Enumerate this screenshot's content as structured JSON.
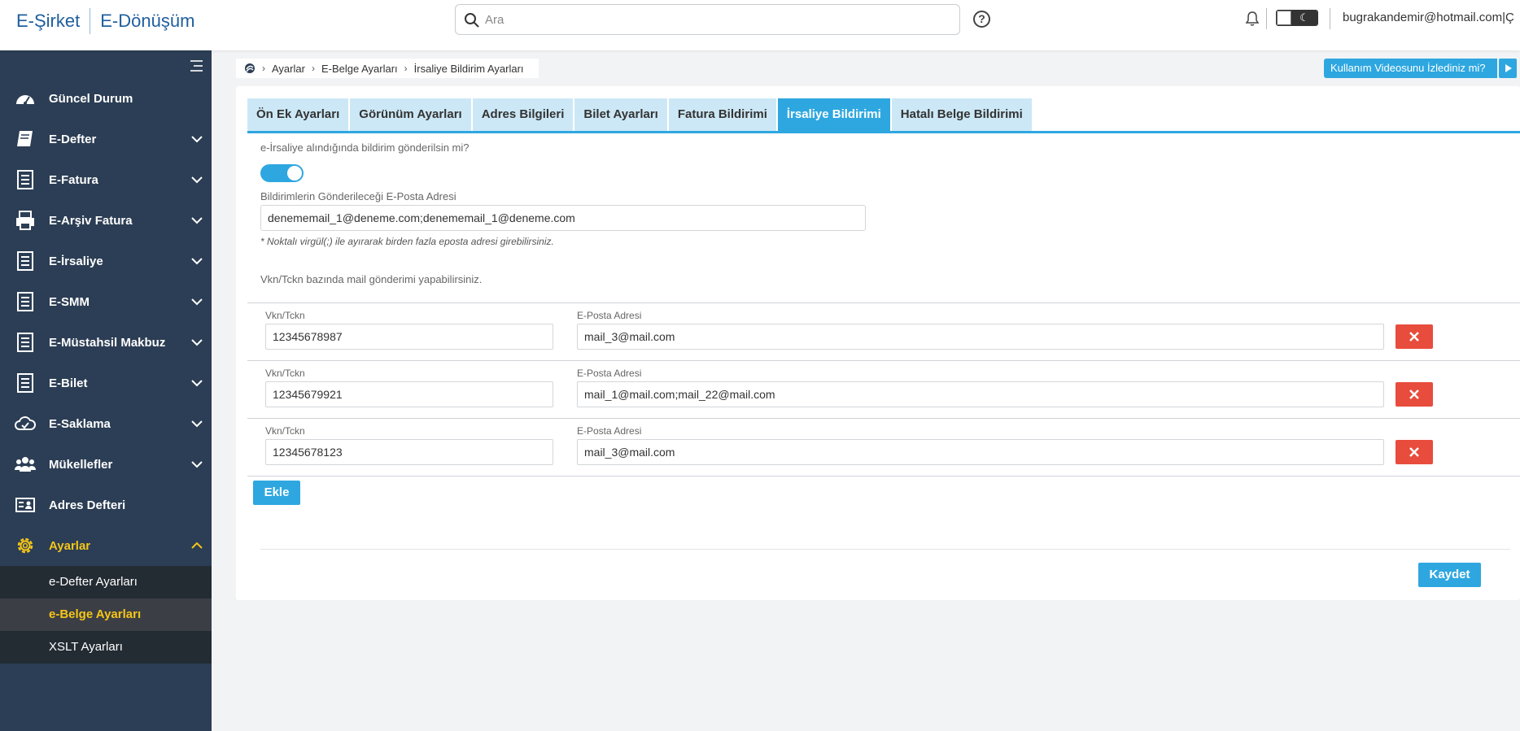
{
  "header": {
    "brand_left": "E-Şirket",
    "brand_right": "E-Dönüşüm",
    "search_placeholder": "Ara",
    "help_label": "?",
    "user_email": "bugrakandemir@hotmail.com|Ç"
  },
  "sidebar": {
    "items": [
      {
        "label": "Güncel Durum",
        "icon": "dashboard-icon"
      },
      {
        "label": "E-Defter",
        "icon": "book-icon"
      },
      {
        "label": "E-Fatura",
        "icon": "receipt-icon"
      },
      {
        "label": "E-Arşiv Fatura",
        "icon": "printer-icon"
      },
      {
        "label": "E-İrsaliye",
        "icon": "receipt-icon"
      },
      {
        "label": "E-SMM",
        "icon": "receipt-icon"
      },
      {
        "label": "E-Müstahsil Makbuz",
        "icon": "receipt-icon"
      },
      {
        "label": "E-Bilet",
        "icon": "receipt-icon"
      },
      {
        "label": "E-Saklama",
        "icon": "cloud-icon"
      },
      {
        "label": "Mükellefler",
        "icon": "users-icon"
      },
      {
        "label": "Adres Defteri",
        "icon": "contact-card-icon"
      },
      {
        "label": "Ayarlar",
        "icon": "gear-icon"
      }
    ],
    "subitems": [
      {
        "label": "e-Defter Ayarları"
      },
      {
        "label": "e-Belge Ayarları"
      },
      {
        "label": "XSLT Ayarları"
      }
    ],
    "active_color": "#f5c518"
  },
  "breadcrumb": {
    "items": [
      "Ayarlar",
      "E-Belge Ayarları",
      "İrsaliye Bildirim Ayarları"
    ]
  },
  "video_button": "Kullanım Videosunu İzlediniz mi?",
  "tabs": [
    {
      "label": "Ön Ek Ayarları"
    },
    {
      "label": "Görünüm Ayarları"
    },
    {
      "label": "Adres Bilgileri"
    },
    {
      "label": "Bilet Ayarları"
    },
    {
      "label": "Fatura Bildirimi"
    },
    {
      "label": "İrsaliye Bildirimi"
    },
    {
      "label": "Hatalı Belge Bildirimi"
    }
  ],
  "form": {
    "question": "e-İrsaliye alındığında bildirim gönderilsin mi?",
    "notify_enabled": true,
    "email_label": "Bildirimlerin Gönderileceği E-Posta Adresi",
    "email_value": "denememail_1@deneme.com;denememail_1@deneme.com",
    "hint": "* Noktalı virgül(;) ile ayırarak birden fazla eposta adresi girebilirsiniz.",
    "vkn_info": "Vkn/Tckn bazında mail gönderimi yapabilirsiniz."
  },
  "rows": [
    {
      "vkn_label": "Vkn/Tckn",
      "vkn": "12345678987",
      "email_label": "E-Posta Adresi",
      "email": "mail_3@mail.com"
    },
    {
      "vkn_label": "Vkn/Tckn",
      "vkn": "12345679921",
      "email_label": "E-Posta Adresi",
      "email": "mail_1@mail.com;mail_22@mail.com"
    },
    {
      "vkn_label": "Vkn/Tckn",
      "vkn": "12345678123",
      "email_label": "E-Posta Adresi",
      "email": "mail_3@mail.com"
    }
  ],
  "buttons": {
    "add": "Ekle",
    "save": "Kaydet"
  },
  "colors": {
    "primary": "#2ea7e0",
    "danger": "#e74c3c",
    "sidebar_bg": "#2c3e55",
    "brand": "#1f5e9e"
  }
}
